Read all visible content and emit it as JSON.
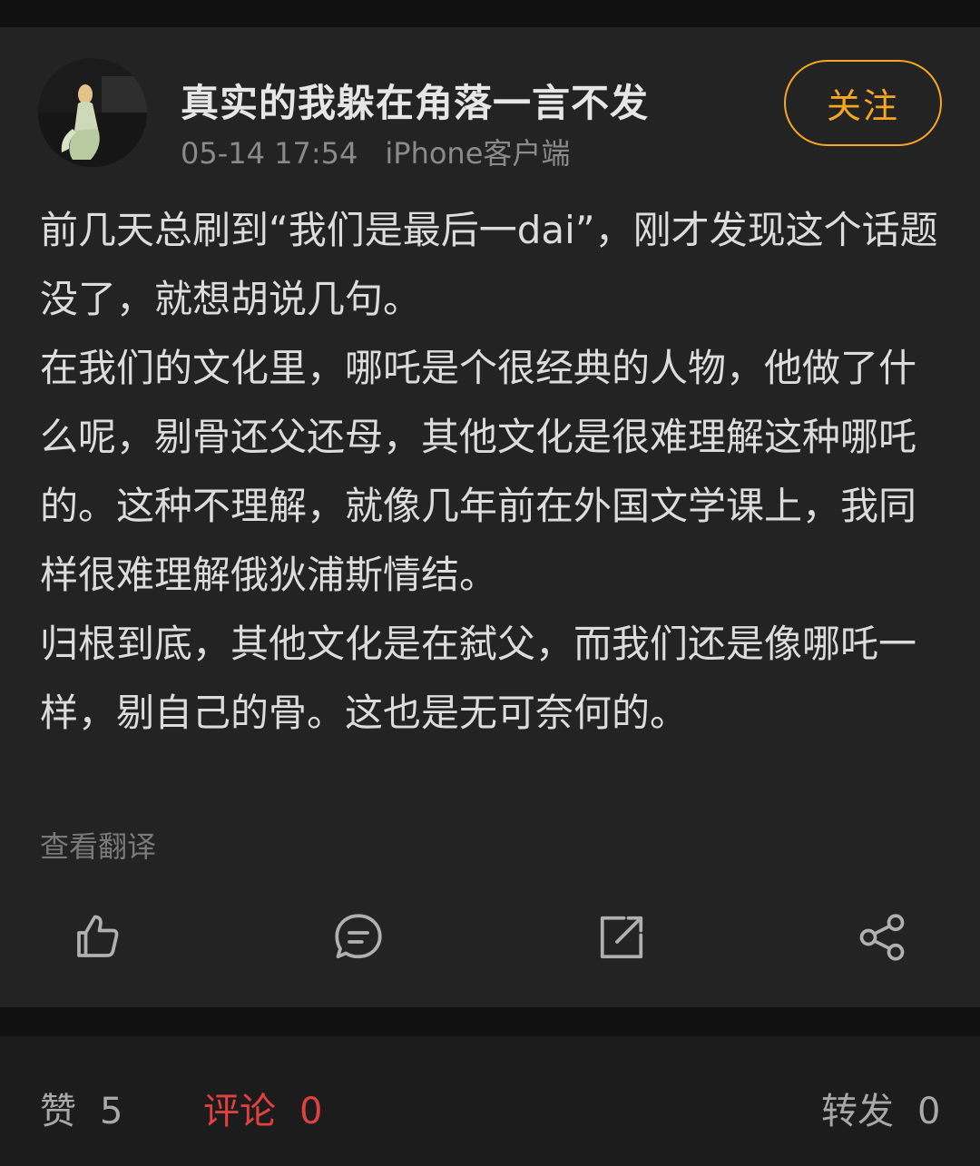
{
  "post": {
    "username": "真实的我躲在角落一言不发",
    "time": "05-14 17:54",
    "source": "iPhone客户端",
    "follow_label": "关注",
    "body": [
      "前几天总刷到“我们是最后一dai”，刚才发现这个话题没了，就想胡说几句。",
      "在我们的文化里，哪吒是个很经典的人物，他做了什么呢，剔骨还父还母，其他文化是很难理解这种哪吒的。这种不理解，就像几年前在外国文学课上，我同样很难理解俄狄浦斯情结。",
      "归根到底，其他文化是在弑父，而我们还是像哪吒一样，剔自己的骨。这也是无可奈何的。"
    ],
    "translate_label": "查看翻译"
  },
  "actions": {
    "like_icon": "thumbs-up-icon",
    "comment_icon": "comment-icon",
    "repost_icon": "repost-icon",
    "share_icon": "share-icon"
  },
  "stats": {
    "likes_label": "赞",
    "likes_count": "5",
    "comments_label": "评论",
    "comments_count": "0",
    "reposts_label": "转发",
    "reposts_count": "0"
  },
  "colors": {
    "accent": "#f5a623",
    "active_tab": "#e04040"
  }
}
